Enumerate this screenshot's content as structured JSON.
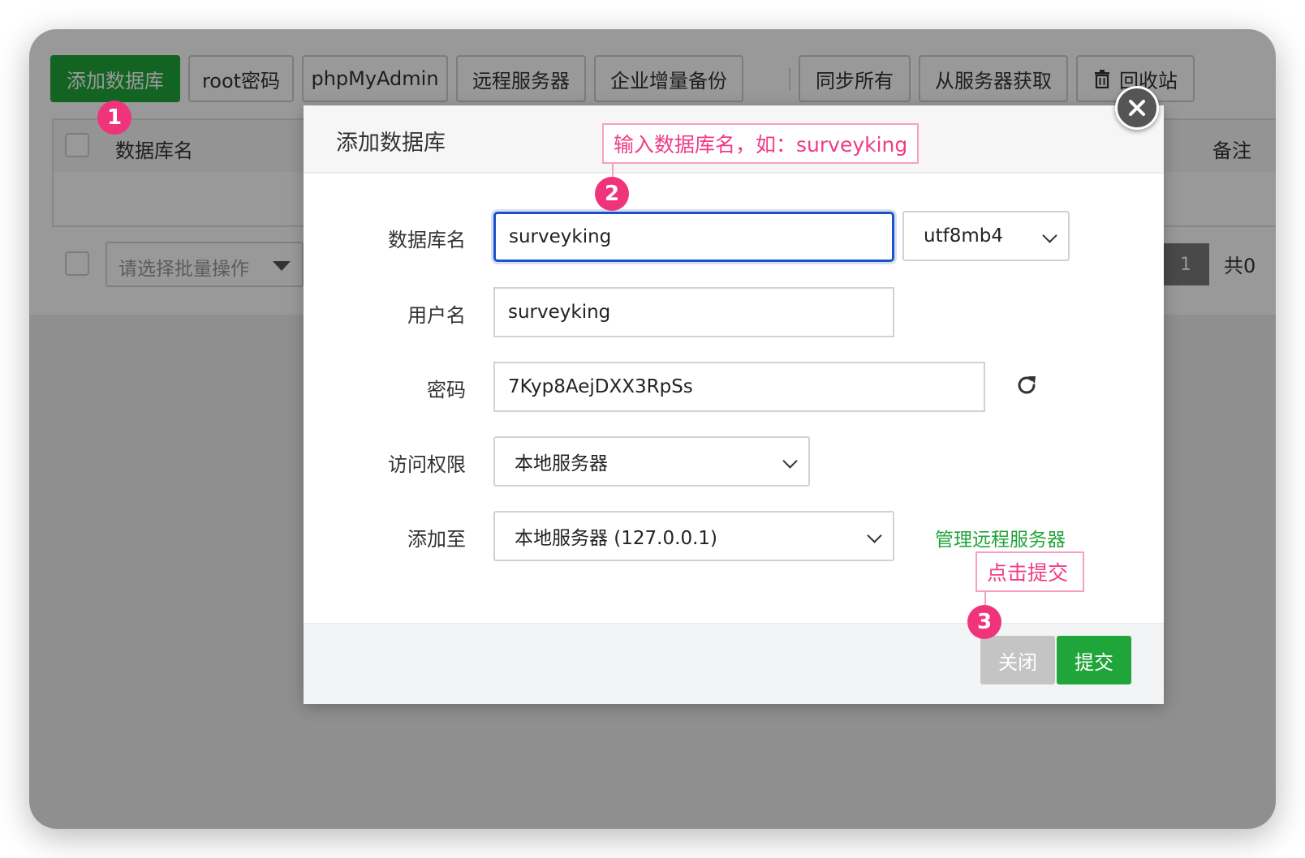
{
  "toolbar": {
    "add_db": "添加数据库",
    "root_pwd": "root密码",
    "phpmyadmin": "phpMyAdmin",
    "remote_server": "远程服务器",
    "enterprise_backup": "企业增量备份",
    "sync_all": "同步所有",
    "fetch_from_server": "从服务器获取",
    "recycle_bin": "回收站"
  },
  "table": {
    "col_name": "数据库名",
    "col_note": "备注"
  },
  "batch": {
    "placeholder": "请选择批量操作"
  },
  "pagination": {
    "current": "1",
    "total_label": "共0"
  },
  "modal": {
    "title": "添加数据库",
    "fields": {
      "db_name_label": "数据库名",
      "db_name_value": "surveyking",
      "charset_value": "utf8mb4",
      "username_label": "用户名",
      "username_value": "surveyking",
      "password_label": "密码",
      "password_value": "7Kyp8AejDXX3RpSs",
      "access_label": "访问权限",
      "access_value": "本地服务器",
      "add_to_label": "添加至",
      "add_to_value": "本地服务器 (127.0.0.1)",
      "manage_remote": "管理远程服务器"
    },
    "buttons": {
      "close": "关闭",
      "submit": "提交"
    }
  },
  "annotations": {
    "step1": "1",
    "step2": "2",
    "step3": "3",
    "callout2": "输入数据库名，如：surveyking",
    "callout3": "点击提交"
  },
  "colors": {
    "primary_green": "#20a53a",
    "focus_blue": "#1a52c8",
    "annotation_pink": "#f0347c"
  }
}
